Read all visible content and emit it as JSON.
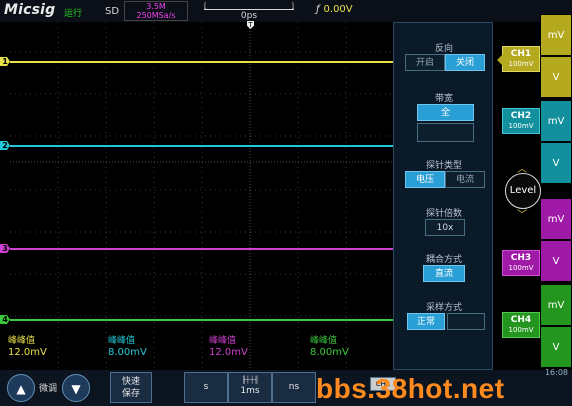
{
  "header": {
    "logo": "Micsig",
    "run_status": "运行",
    "sd_label": "SD",
    "memory_depth": "3.5M",
    "sample_rate": "250MSa/s",
    "time_left": "[",
    "time_right": "]",
    "time_offset": "0ps",
    "trigger_edge": "ƒ",
    "trigger_level": "0.00V"
  },
  "channel_markers": [
    "1",
    "2",
    "3",
    "4"
  ],
  "trigger_marker": "T",
  "measurements": [
    {
      "label": "峰峰值",
      "value": "12.0mV",
      "color": "#e8e04a"
    },
    {
      "label": "峰峰值",
      "value": "8.00mV",
      "color": "#22c8d8"
    },
    {
      "label": "峰峰值",
      "value": "12.0mV",
      "color": "#d040d0"
    },
    {
      "label": "峰峰值",
      "value": "8.00mV",
      "color": "#3cc83c"
    }
  ],
  "settings_panel": {
    "invert": {
      "label": "反向",
      "options": [
        "开启",
        "关闭"
      ],
      "selected": "关闭"
    },
    "bandwidth": {
      "label": "带宽",
      "value": "全"
    },
    "probe_type": {
      "label": "探针类型",
      "options": [
        "电压",
        "电流"
      ],
      "selected": "电压"
    },
    "probe_ratio": {
      "label": "探针倍数",
      "value": "10x"
    },
    "coupling": {
      "label": "耦合方式",
      "value": "直流"
    },
    "acquire": {
      "label": "采样方式",
      "value": "正常"
    }
  },
  "channels": [
    {
      "name": "CH1",
      "scale": "100mV",
      "color": "#c9bd2a"
    },
    {
      "name": "CH2",
      "scale": "100mV",
      "color": "#1aa0b0"
    },
    {
      "name": "CH3",
      "scale": "100mV",
      "color": "#b22ab8"
    },
    {
      "name": "CH4",
      "scale": "100mV",
      "color": "#2ca82c"
    }
  ],
  "right_buttons": {
    "ch1": [
      "mV",
      "V"
    ],
    "ch2": [
      "mV",
      "V"
    ],
    "ch3": [
      "mV",
      "V"
    ],
    "ch4": [
      "mV",
      "V"
    ]
  },
  "level_label": "Level",
  "bottom": {
    "fine_label": "微调",
    "quick_save": "快速\n保存",
    "time_units": [
      "s",
      "1ms",
      "ns"
    ],
    "ch_badge": "CH1",
    "clock": "16:08",
    "watermark": "bbs.38hot.net"
  }
}
